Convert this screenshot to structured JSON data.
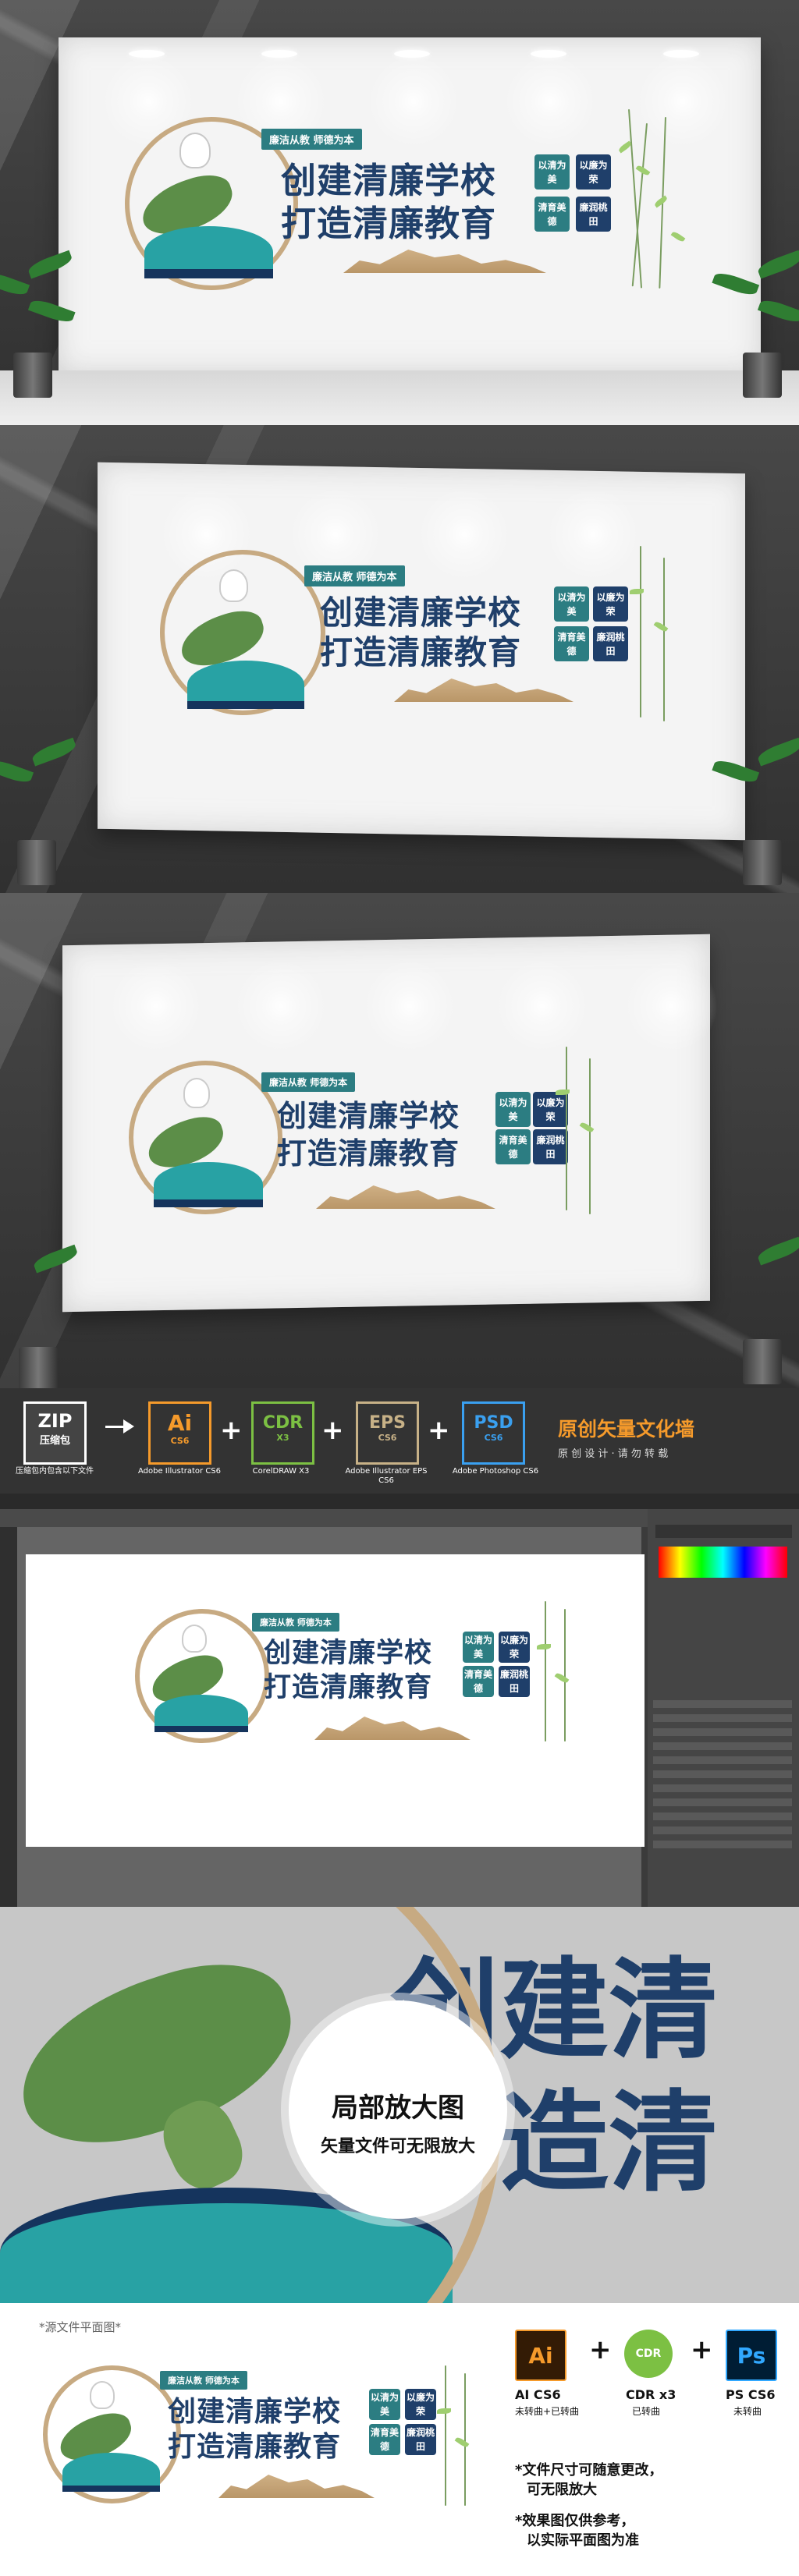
{
  "artwork": {
    "slogan": "廉洁从教 师德为本",
    "title_1": "创建清廉学校",
    "title_2": "打造清廉教育",
    "tags": [
      "以清为美",
      "以廉为荣",
      "清育美德",
      "廉润桃田"
    ]
  },
  "toolbar": {
    "zip_label": "ZIP",
    "zip_caption": "压缩包",
    "zip_note": "压缩包内包含以下文件",
    "ai_label": "Ai",
    "ai_version": "CS6",
    "ai_caption": "Adobe Illustrator CS6",
    "cdr_label": "CDR",
    "cdr_version": "X3",
    "cdr_caption": "CorelDRAW X3",
    "eps_label": "EPS",
    "eps_version": "CS6",
    "eps_caption": "Adobe Illustrator EPS CS6",
    "psd_label": "PSD",
    "psd_version": "CS6",
    "psd_caption": "Adobe Photoshop CS6",
    "brand": "原创矢量文化墙",
    "brand_sub": "原 创 设 计 · 请 勿 转 载"
  },
  "zoom": {
    "title": "局部放大图",
    "subtitle": "矢量文件可无限放大",
    "bg_text_1": "创建清",
    "bg_text_2": "打造清"
  },
  "bottom": {
    "source_label": "*源文件平面图*",
    "formats": [
      {
        "icon": "Ai",
        "label": "AI CS6",
        "sub": "未转曲+已转曲"
      },
      {
        "icon": "CDR",
        "label": "CDR x3",
        "sub": "已转曲"
      },
      {
        "icon": "Ps",
        "label": "PS CS6",
        "sub": "未转曲"
      }
    ],
    "note_1": "*文件尺寸可随意更改，",
    "note_1b": "可无限放大",
    "note_2": "*效果图仅供参考，",
    "note_2b": "以实际平面图为准"
  },
  "colors": {
    "navy": "#1f3f6a",
    "teal": "#2c7d82",
    "gold": "#c7aa82",
    "lotus_green": "#5c8e48",
    "orange": "#f59a2b"
  }
}
